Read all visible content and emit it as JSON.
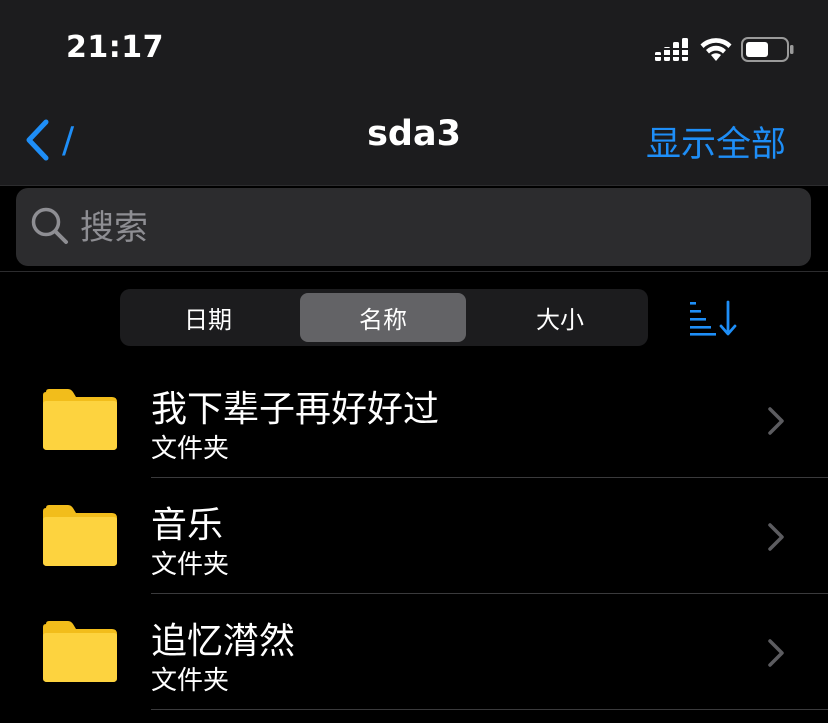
{
  "status_bar": {
    "time": "21:17"
  },
  "nav": {
    "back_label": "/",
    "title": "sda3",
    "right_action": "显示全部"
  },
  "search": {
    "placeholder": "搜索"
  },
  "sort": {
    "segments": [
      "日期",
      "名称",
      "大小"
    ],
    "selected": "名称"
  },
  "items": [
    {
      "name": "我下辈子再好好过",
      "kind": "文件夹",
      "icon": "folder-icon"
    },
    {
      "name": "音乐",
      "kind": "文件夹",
      "icon": "folder-icon"
    },
    {
      "name": "追忆潸然",
      "kind": "文件夹",
      "icon": "folder-icon"
    }
  ],
  "colors": {
    "accent": "#1e8ef7",
    "folder": "#fdd33f",
    "folder_tab": "#f2bd1b",
    "header_bg": "#1c1c1e",
    "segment_active": "#636366"
  }
}
